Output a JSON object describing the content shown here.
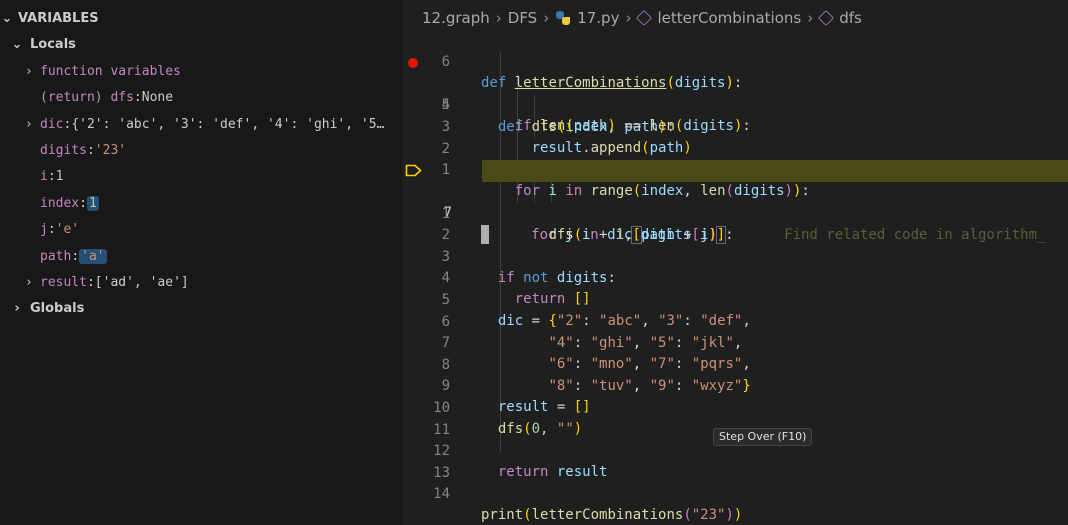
{
  "variables_panel": {
    "title": "VARIABLES",
    "sections": {
      "locals": "Locals",
      "globals": "Globals"
    },
    "items": {
      "function_variables": "function variables",
      "return_name": "(return) dfs",
      "return_value": "None",
      "dic_name": "dic",
      "dic_value": "{'2': 'abc', '3': 'def', '4': 'ghi', '5…",
      "digits_name": "digits",
      "digits_value": "'23'",
      "i_name": "i",
      "i_value": "1",
      "index_name": "index",
      "index_value": "1",
      "j_name": "j",
      "j_value": "'e'",
      "path_name": "path",
      "path_value": "'a'",
      "result_name": "result",
      "result_value": "['ad', 'ae']"
    }
  },
  "editor": {
    "breadcrumb": {
      "folder1": "12.graph",
      "folder2": "DFS",
      "file": "17.py",
      "symbol1": "letterCombinations",
      "symbol2": "dfs"
    },
    "line_numbers": [
      "6",
      "5",
      "4",
      "3",
      "2",
      "1",
      "7",
      "1",
      "2",
      "3",
      "4",
      "5",
      "6",
      "7",
      "8",
      "9",
      "10",
      "11",
      "12",
      "13",
      "14"
    ],
    "inline_hint": "Find related code in algorithm_",
    "colors": {
      "current_line_bg": "#4b4b18",
      "breakpoint": "#e51400"
    }
  },
  "tooltip": {
    "text": "Step Over (F10)"
  }
}
